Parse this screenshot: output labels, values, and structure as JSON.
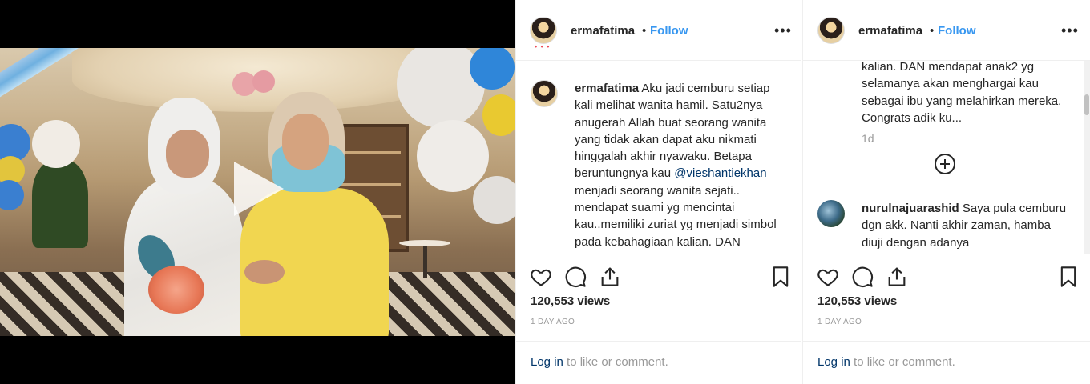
{
  "colors": {
    "link": "#3897f0",
    "mention": "#003569",
    "text": "#262626",
    "muted": "#999999",
    "live_dot": "#ed4956"
  },
  "video": {
    "play_icon": "play-icon"
  },
  "post_a": {
    "header": {
      "username": "ermafatima",
      "separator": "•",
      "follow": "Follow",
      "more": "•••",
      "live_dots": "• • •"
    },
    "caption": {
      "username": "ermafatima",
      "text_before_mention": " Aku jadi cemburu setiap kali melihat wanita hamil. Satu2nya anugerah Allah buat seorang wanita yang tidak akan dapat aku nikmati hinggalah akhir nyawaku. Betapa beruntungnya kau ",
      "mention": "@vieshantiekhan",
      "text_after_mention": " menjadi seorang wanita sejati.. mendapat suami yg mencintai kau..memiliki zuriat yg menjadi simbol pada kebahagiaan kalian. DAN mendapat anak2 yg"
    },
    "views": "120,553 views",
    "time_ago": "1 DAY AGO",
    "login": {
      "link": "Log in",
      "rest": " to like or comment."
    }
  },
  "post_b": {
    "header": {
      "username": "ermafatima",
      "separator": "•",
      "follow": "Follow",
      "more": "•••"
    },
    "caption_tail": "kalian. DAN mendapat anak2 yg selamanya akan menghargai kau sebagai ibu yang melahirkan mereka. Congrats adik ku...",
    "caption_time": "1d",
    "load_more_icon": "plus-circle-icon",
    "comment": {
      "username": "nurulnajuarashid",
      "text": " Saya pula cemburu dgn akk. Nanti akhir zaman, hamba diuji dengan adanya"
    },
    "views": "120,553 views",
    "time_ago": "1 DAY AGO",
    "login": {
      "link": "Log in",
      "rest": " to like or comment."
    }
  }
}
